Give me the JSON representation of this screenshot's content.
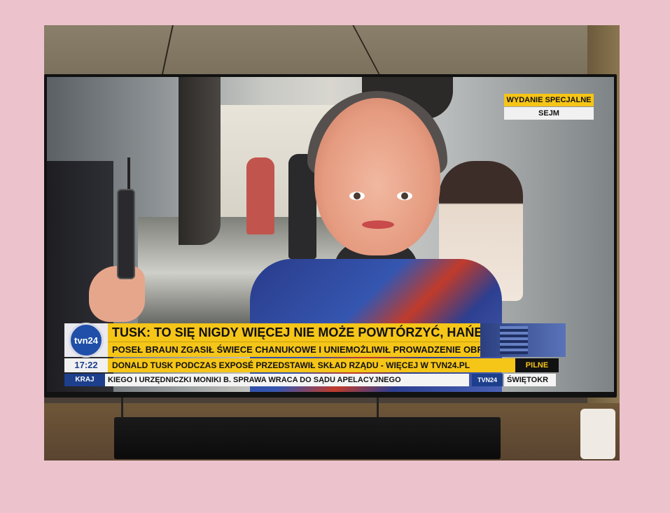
{
  "scene": {
    "description_free": true
  },
  "tv_graphics": {
    "badge_top": "WYDANIE SPECJALNE",
    "badge_bottom": "SEJM",
    "logo_text": "tvn24",
    "headline": "TUSK: TO SIĘ NIGDY WIĘCEJ NIE MOŻE POWTÓRZYĆ, HAŃBA",
    "subheadline": "POSEŁ BRAUN ZGASIŁ ŚWIECE CHANUKOWE I UNIEMOŻLIWIŁ PROWADZENIE OBRAD",
    "time": "17:22",
    "ticker_main": "DONALD TUSK PODCZAS EXPOSÉ PRZEDSTAWIŁ SKŁAD RZĄDU - WIĘCEJ W TVN24.PL",
    "ticker_tag": "PILNE",
    "section_label": "KRAJ",
    "ticker_news": "KIEGO I URZĘDNICZKI MONIKI B. SPRAWA WRACA DO SĄDU APELACYJNEGO",
    "channel_chip": "TVN24",
    "ticker_next": "ŚWIĘTOKR"
  },
  "colors": {
    "background_pink": "#ecc3cc",
    "tvn_yellow": "#f5c518",
    "tvn_blue": "#1d3f8c"
  }
}
